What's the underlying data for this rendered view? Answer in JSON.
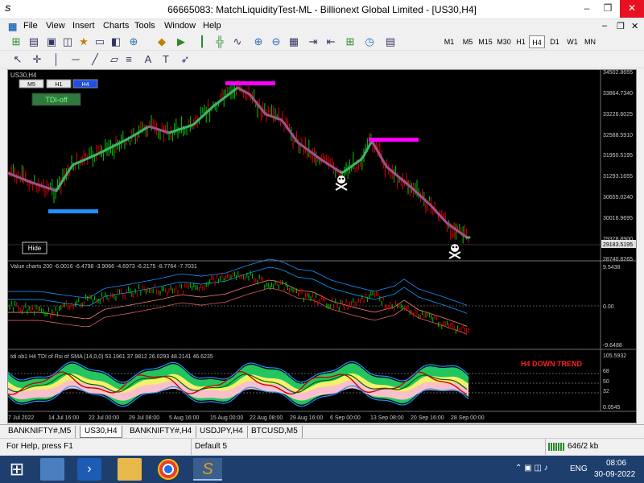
{
  "window": {
    "title": "66665083: MatchLiquidityTest-ML - Billionext Global Limited - [US30,H4]",
    "logo": "S",
    "minimize": "–",
    "maximize": "❐",
    "close": "✕"
  },
  "menu": {
    "items": [
      "File",
      "View",
      "Insert",
      "Charts",
      "Tools",
      "Window",
      "Help"
    ],
    "mdi_controls": [
      "–",
      "❐",
      "✕"
    ]
  },
  "toolbar": {
    "timeframes": [
      "M1",
      "M5",
      "M15",
      "M30",
      "H1",
      "H4",
      "D1",
      "W1",
      "MN"
    ],
    "active_timeframe": "H4"
  },
  "chart": {
    "symbol_label": "US30,H4",
    "tf_buttons": [
      "M5",
      "H1",
      "H4"
    ],
    "tdi_button": "TDI-off",
    "hide_button": "Hide",
    "price_axis": [
      "34502.8655",
      "33864.7340",
      "33226.6025",
      "32588.5910",
      "31950.5195",
      "31293.1655",
      "30655.0240",
      "30016.9695",
      "29378.8900",
      "28740.8265"
    ],
    "current_price": "29183.5195",
    "value_panel_label": "Value charts 200 -6.0016 -6.4798 -3.9066 -4.6973 -6.2175 -8.7764 -7.7031",
    "value_axis": [
      "9.5438",
      "0.00",
      "-9.6488"
    ],
    "tdi_panel_label": "tdi ob1 H4 TDI of Rsi of SMA (14,0,0) 53.1961 37.9812 26.0293 48.2141 46.6235",
    "tdi_axis": [
      "105.5932",
      "68",
      "50",
      "32",
      "0.0545"
    ],
    "trend_label": "H4 DOWN TREND",
    "time_axis": [
      "7 Jul 2022",
      "14 Jul 16:00",
      "22 Jul 00:00",
      "29 Jul 08:00",
      "5 Aug 16:00",
      "15 Aug 00:00",
      "22 Aug 08:00",
      "29 Aug 16:00",
      "6 Sep 00:00",
      "13 Sep 08:00",
      "20 Sep 16:00",
      "28 Sep 00:00"
    ],
    "colors": {
      "background": "#000000",
      "bull_candle": "#00c800",
      "bear_candle": "#e00000",
      "ma_up": "#3cb371",
      "ma_down": "#a0508c",
      "magenta_level": "#ff00ff",
      "blue_level": "#1e90ff",
      "trend_text": "#ff2020"
    }
  },
  "tabs": {
    "items": [
      "BANKNIFTY#,M5",
      "US30,H4",
      "BANKNIFTY#,H4",
      "USDJPY,H4",
      "BTCUSD,M5"
    ],
    "active": "US30,H4"
  },
  "status": {
    "help_text": "For Help, press F1",
    "profile": "Default 5",
    "traffic": "646/2 kb"
  },
  "taskbar": {
    "language": "ENG",
    "time": "08:06",
    "date": "30-09-2022"
  }
}
